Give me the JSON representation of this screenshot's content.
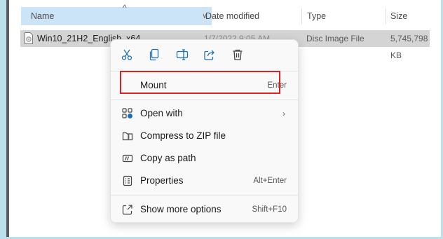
{
  "columns": {
    "name": "Name",
    "date_modified": "Date modified",
    "type": "Type",
    "size": "Size"
  },
  "file": {
    "name": "Win10_21H2_English_x64",
    "date_modified": "1/7/2022 9:05 AM",
    "type": "Disc Image File",
    "size": "5,745,798 KB"
  },
  "toolbar": {
    "cut_icon": "scissors-icon",
    "copy_icon": "copy-icon",
    "rename_icon": "rename-icon",
    "share_icon": "share-icon",
    "delete_icon": "trash-icon"
  },
  "menu": {
    "mount": {
      "label": "Mount",
      "shortcut": "Enter"
    },
    "open_with": {
      "label": "Open with"
    },
    "compress": {
      "label": "Compress to ZIP file"
    },
    "copy_path": {
      "label": "Copy as path"
    },
    "properties": {
      "label": "Properties",
      "shortcut": "Alt+Enter"
    },
    "more_options": {
      "label": "Show more options",
      "shortcut": "Shift+F10"
    }
  },
  "colors": {
    "selection": "#d4d4d4",
    "header_highlight": "#cce4f7",
    "icon_blue": "#1f6fb4",
    "annotation_red": "#e02020"
  }
}
